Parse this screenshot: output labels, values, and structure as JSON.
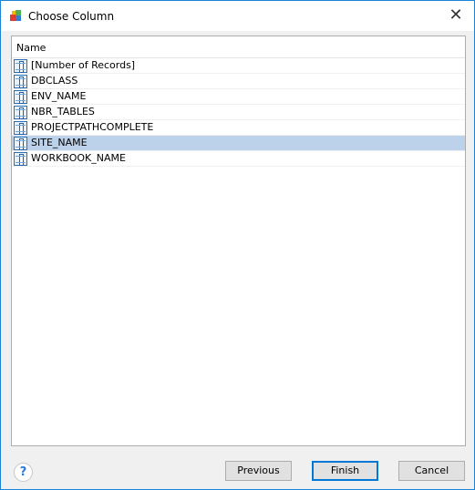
{
  "window": {
    "title": "Choose Column",
    "close_label": "✕"
  },
  "list": {
    "header": "Name",
    "selected_index": 5,
    "items": [
      "[Number of Records]",
      "DBCLASS",
      "ENV_NAME",
      "NBR_TABLES",
      "PROJECTPATHCOMPLETE",
      "SITE_NAME",
      "WORKBOOK_NAME"
    ]
  },
  "buttons": {
    "help": "?",
    "previous": "Previous",
    "finish": "Finish",
    "cancel": "Cancel"
  },
  "colors": {
    "accent": "#0078d7",
    "selection": "#bcd2ea"
  }
}
